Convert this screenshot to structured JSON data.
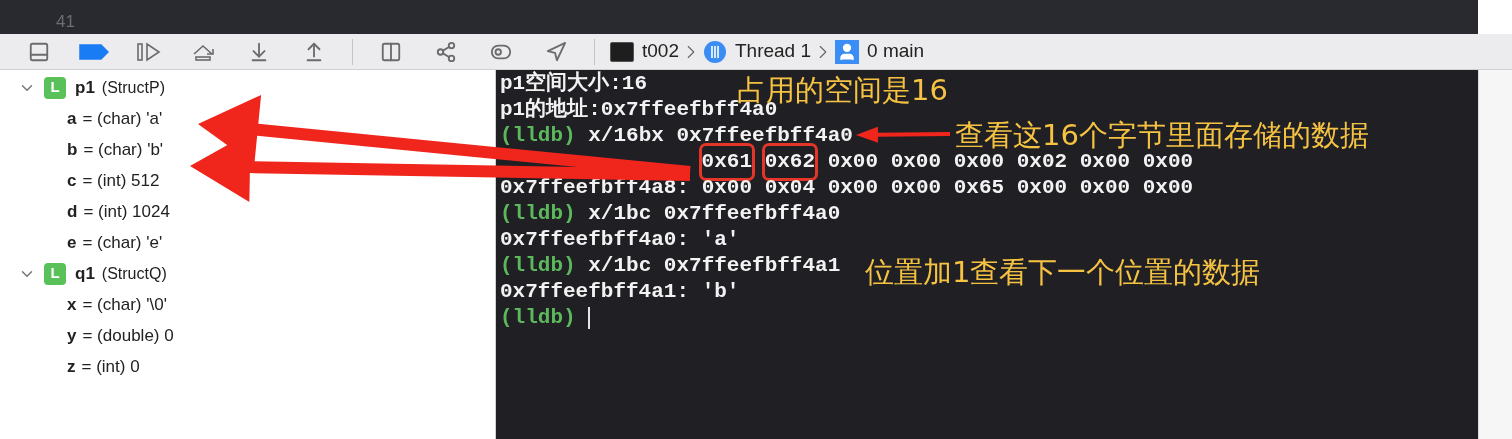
{
  "editor": {
    "line_number": "41"
  },
  "toolbar": {
    "breakpoints_active": true,
    "breadcrumb": [
      {
        "kind": "process",
        "label": "t002"
      },
      {
        "kind": "thread",
        "label": "Thread 1"
      },
      {
        "kind": "frame",
        "label": "0 main"
      }
    ]
  },
  "variables": [
    {
      "name": "p1",
      "type": "(StructP)",
      "scope": "L",
      "expanded": true,
      "children": [
        {
          "name": "a",
          "value": "= (char) 'a'"
        },
        {
          "name": "b",
          "value": "= (char) 'b'"
        },
        {
          "name": "c",
          "value": "= (int) 512"
        },
        {
          "name": "d",
          "value": "= (int) 1024"
        },
        {
          "name": "e",
          "value": "= (char) 'e'"
        }
      ]
    },
    {
      "name": "q1",
      "type": "(StructQ)",
      "scope": "L",
      "expanded": true,
      "children": [
        {
          "name": "x",
          "value": "= (char) '\\0'"
        },
        {
          "name": "y",
          "value": "= (double) 0"
        },
        {
          "name": "z",
          "value": "= (int) 0"
        }
      ]
    }
  ],
  "console": {
    "lines": [
      {
        "kind": "output",
        "text": "p1空间大小:16"
      },
      {
        "kind": "output",
        "text": "p1的地址:0x7ffeefbff4a0"
      },
      {
        "kind": "command",
        "prompt": "(lldb)",
        "text": "x/16bx 0x7ffeefbff4a0"
      },
      {
        "kind": "memory",
        "bytes": [
          {
            "text": "0x61",
            "boxed": true
          },
          {
            "text": "0x62",
            "boxed": true
          },
          {
            "text": "0x00",
            "boxed": false
          },
          {
            "text": "0x00",
            "boxed": false
          },
          {
            "text": "0x00",
            "boxed": false
          },
          {
            "text": "0x02",
            "boxed": false
          },
          {
            "text": "0x00",
            "boxed": false
          },
          {
            "text": "0x00",
            "boxed": false
          }
        ]
      },
      {
        "kind": "memory",
        "address": "0x7ffeefbff4a8:",
        "bytes": [
          {
            "text": "0x00",
            "boxed": false
          },
          {
            "text": "0x04",
            "boxed": false
          },
          {
            "text": "0x00",
            "boxed": false
          },
          {
            "text": "0x00",
            "boxed": false
          },
          {
            "text": "0x65",
            "boxed": false
          },
          {
            "text": "0x00",
            "boxed": false
          },
          {
            "text": "0x00",
            "boxed": false
          },
          {
            "text": "0x00",
            "boxed": false
          }
        ]
      },
      {
        "kind": "command",
        "prompt": "(lldb)",
        "text": "x/1bc 0x7ffeefbff4a0"
      },
      {
        "kind": "output",
        "text": "0x7ffeefbff4a0: 'a'"
      },
      {
        "kind": "command",
        "prompt": "(lldb)",
        "text": "x/1bc 0x7ffeefbff4a1"
      },
      {
        "kind": "output",
        "text": "0x7ffeefbff4a1: 'b'"
      },
      {
        "kind": "prompt",
        "prompt": "(lldb)"
      }
    ]
  },
  "annotations": [
    {
      "text": "占用的空间是16"
    },
    {
      "text": "查看这16个字节里面存储的数据"
    },
    {
      "text": "位置加1查看下一个位置的数据"
    }
  ]
}
